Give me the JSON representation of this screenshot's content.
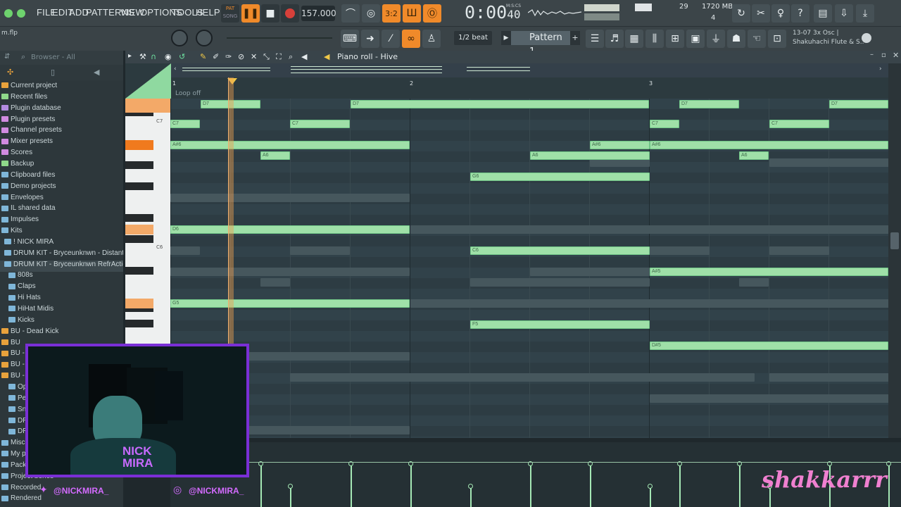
{
  "menu": [
    "FILE",
    "EDIT",
    "ADD",
    "PATTERNS",
    "VIEW",
    "OPTIONS",
    "TOOLS",
    "HELP"
  ],
  "transport": {
    "pat_label": "PAT",
    "song_label": "SONG",
    "tempo": "157.000",
    "time": "0:00",
    "time_sub": "40",
    "time_unit": "M:S:CS"
  },
  "cpu": {
    "value": "29",
    "memory": "1720 MB",
    "poly": "4"
  },
  "file_name": "m.flp",
  "snap": "1/2 beat",
  "pattern": "Pattern 1",
  "plugin_info": {
    "line1": "13-07  3x Osc |",
    "line2": "Shakuhachi Flute & S.."
  },
  "browser": {
    "title": "Browser - All",
    "items": [
      {
        "label": "Current project",
        "color": "#e8a23c"
      },
      {
        "label": "Recent files",
        "color": "#8fd88a"
      },
      {
        "label": "Plugin database",
        "color": "#b38be0"
      },
      {
        "label": "Plugin presets",
        "color": "#d18be0"
      },
      {
        "label": "Channel presets",
        "color": "#d18be0"
      },
      {
        "label": "Mixer presets",
        "color": "#d18be0"
      },
      {
        "label": "Scores",
        "color": "#d18be0"
      },
      {
        "label": "Backup",
        "color": "#8fd88a"
      },
      {
        "label": "Clipboard files",
        "color": "#7fb6d8"
      },
      {
        "label": "Demo projects",
        "color": "#7fb6d8"
      },
      {
        "label": "Envelopes",
        "color": "#7fb6d8"
      },
      {
        "label": "IL shared data",
        "color": "#7fb6d8"
      },
      {
        "label": "Impulses",
        "color": "#7fb6d8"
      },
      {
        "label": "Kits",
        "color": "#7fb6d8"
      },
      {
        "label": "! NICK MIRA",
        "color": "#7fb6d8"
      },
      {
        "label": "DRUM KIT - Bryceunknwn - Distant",
        "color": "#7fb6d8"
      },
      {
        "label": "DRUM KIT - Bryceunknwn RefrAction",
        "color": "#7fb6d8"
      },
      {
        "label": "808s",
        "color": "#7fb6d8"
      },
      {
        "label": "Claps",
        "color": "#7fb6d8"
      },
      {
        "label": "Hi Hats",
        "color": "#7fb6d8"
      },
      {
        "label": "HiHat Midis",
        "color": "#7fb6d8"
      },
      {
        "label": "Kicks",
        "color": "#7fb6d8"
      },
      {
        "label": "BU - Dead Kick",
        "color": "#e8a23c"
      },
      {
        "label": "BU",
        "color": "#e8a23c"
      },
      {
        "label": "BU - F",
        "color": "#e8a23c"
      },
      {
        "label": "BU - L",
        "color": "#e8a23c"
      },
      {
        "label": "BU - S",
        "color": "#e8a23c"
      },
      {
        "label": "Op",
        "color": "#7fb6d8"
      },
      {
        "label": "Per",
        "color": "#7fb6d8"
      },
      {
        "label": "Sna",
        "color": "#7fb6d8"
      },
      {
        "label": "DRU",
        "color": "#7fb6d8"
      },
      {
        "label": "DRU",
        "color": "#7fb6d8"
      },
      {
        "label": "Misc",
        "color": "#7fb6d8"
      },
      {
        "label": "My p",
        "color": "#7fb6d8"
      },
      {
        "label": "Packs",
        "color": "#7fb6d8"
      },
      {
        "label": "Project bones",
        "color": "#7fb6d8"
      },
      {
        "label": "Recorded",
        "color": "#7fb6d8"
      },
      {
        "label": "Rendered",
        "color": "#7fb6d8"
      }
    ]
  },
  "piano_roll": {
    "title": "Piano roll - Hive",
    "loop": "Loop off",
    "bars": [
      "1",
      "2",
      "3"
    ],
    "key_labels": [
      "C7",
      "C6"
    ],
    "notes": [
      {
        "label": "D7"
      },
      {
        "label": "D7"
      },
      {
        "label": "D7"
      },
      {
        "label": "D7"
      },
      {
        "label": "C7"
      },
      {
        "label": "C7"
      },
      {
        "label": "C7"
      },
      {
        "label": "C7"
      },
      {
        "label": "A#6"
      },
      {
        "label": "A#6"
      },
      {
        "label": "A#6"
      },
      {
        "label": "A6"
      },
      {
        "label": "A6"
      },
      {
        "label": "A6"
      },
      {
        "label": "G6"
      },
      {
        "label": "D6"
      },
      {
        "label": "C6"
      },
      {
        "label": "A#5"
      },
      {
        "label": "G5"
      },
      {
        "label": "F5"
      },
      {
        "label": "D#5"
      }
    ]
  },
  "overlay": {
    "social_handle": "@NICKMIRA_",
    "social_handle2": "@NICKMIRA_",
    "logo_text": "NICK MIRA",
    "watermark": "shakkarrr"
  },
  "colors": {
    "accent": "#f08a2a",
    "note": "#9fe0a8",
    "frame": "#7a2fd6"
  }
}
